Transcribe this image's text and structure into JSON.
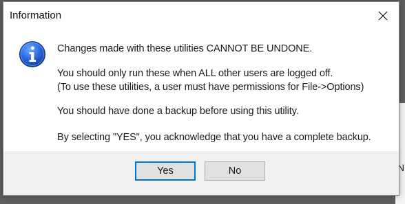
{
  "dialog": {
    "title": "Information",
    "close_icon": "close-icon",
    "icon": "info-icon",
    "messages": [
      "Changes made with these utilities CANNOT BE UNDONE.",
      "You should only run these when ALL other users are logged off.",
      "(To use these utilities, a user must have permissions for File->Options)",
      "You should have done a backup before using this utility.",
      "By selecting \"YES\", you acknowledge that you have a complete backup."
    ],
    "buttons": {
      "yes_label": "Yes",
      "no_label": "No"
    }
  },
  "background": {
    "partial_glyph": "N"
  },
  "colors": {
    "default_button_border": "#0078d7",
    "info_icon_blue": "#1f5fd0",
    "footer_bg": "#f0f0f0"
  }
}
